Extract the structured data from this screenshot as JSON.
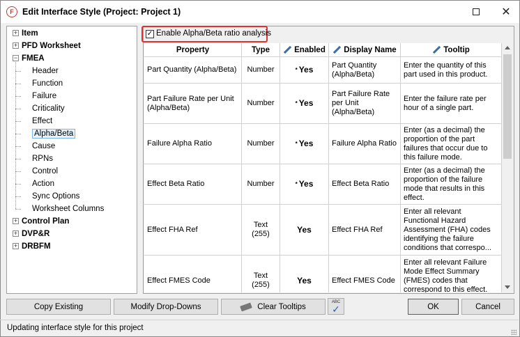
{
  "window": {
    "title": "Edit Interface Style (Project: Project 1)",
    "app_icon_letter": "F"
  },
  "tree": {
    "nodes": [
      {
        "label": "Item",
        "level": 0,
        "expander": "+"
      },
      {
        "label": "PFD Worksheet",
        "level": 0,
        "expander": "+"
      },
      {
        "label": "FMEA",
        "level": 0,
        "expander": "−"
      },
      {
        "label": "Header",
        "level": 1
      },
      {
        "label": "Function",
        "level": 1
      },
      {
        "label": "Failure",
        "level": 1
      },
      {
        "label": "Criticality",
        "level": 1
      },
      {
        "label": "Effect",
        "level": 1
      },
      {
        "label": "Alpha/Beta",
        "level": 1,
        "selected": true
      },
      {
        "label": "Cause",
        "level": 1
      },
      {
        "label": "RPNs",
        "level": 1
      },
      {
        "label": "Control",
        "level": 1
      },
      {
        "label": "Action",
        "level": 1
      },
      {
        "label": "Sync Options",
        "level": 1
      },
      {
        "label": "Worksheet Columns",
        "level": 1
      },
      {
        "label": "Control Plan",
        "level": 0,
        "expander": "+"
      },
      {
        "label": "DVP&R",
        "level": 0,
        "expander": "+"
      },
      {
        "label": "DRBFM",
        "level": 0,
        "expander": "+"
      }
    ]
  },
  "enable_option": {
    "label": "Enable Alpha/Beta ratio analysis",
    "checked": true,
    "check_glyph": "✓"
  },
  "grid": {
    "headers": {
      "property": "Property",
      "type": "Type",
      "enabled": "Enabled",
      "display_name": "Display Name",
      "tooltip": "Tooltip"
    },
    "rows": [
      {
        "property": "Part Quantity (Alpha/Beta)",
        "type": "Number",
        "required": "*",
        "enabled": "Yes",
        "display_name": "Part Quantity (Alpha/Beta)",
        "tooltip": "Enter the quantity of this part used in this product."
      },
      {
        "property": "Part Failure Rate per Unit (Alpha/Beta)",
        "type": "Number",
        "required": "*",
        "enabled": "Yes",
        "display_name": "Part Failure Rate per Unit (Alpha/Beta)",
        "tooltip": "Enter the failure rate per hour of a single part."
      },
      {
        "property": "Failure Alpha Ratio",
        "type": "Number",
        "required": "*",
        "enabled": "Yes",
        "display_name": "Failure Alpha Ratio",
        "tooltip": "Enter (as a decimal) the proportion of the part failures that occur due to this failure mode."
      },
      {
        "property": "Effect Beta Ratio",
        "type": "Number",
        "required": "*",
        "enabled": "Yes",
        "display_name": "Effect Beta Ratio",
        "tooltip": "Enter (as a decimal) the proportion of the failure mode that results in this effect."
      },
      {
        "property": "Effect FHA Ref",
        "type": "Text (255)",
        "required": "",
        "enabled": "Yes",
        "display_name": "Effect FHA Ref",
        "tooltip": "Enter all relevant Functional Hazard Assessment (FHA) codes identifying the failure conditions that correspo..."
      },
      {
        "property": "Effect FMES Code",
        "type": "Text (255)",
        "required": "",
        "enabled": "Yes",
        "display_name": "Effect FMES Code",
        "tooltip": "Enter all relevant Failure Mode Effect Summary (FMES) codes that correspond to this effect. FMES codes and their eff..."
      }
    ]
  },
  "buttons": {
    "copy_existing": "Copy Existing",
    "modify_dropdowns": "Modify Drop-Downs",
    "clear_tooltips": "Clear Tooltips",
    "spell_check_abc": "ABC",
    "spell_check_glyph": "✓",
    "ok": "OK",
    "cancel": "Cancel"
  },
  "status": {
    "text": "Updating interface style for this project"
  },
  "icons": {
    "close": "✕",
    "up_arrow": "up-arrow-icon",
    "down_arrow": "down-arrow-icon"
  }
}
